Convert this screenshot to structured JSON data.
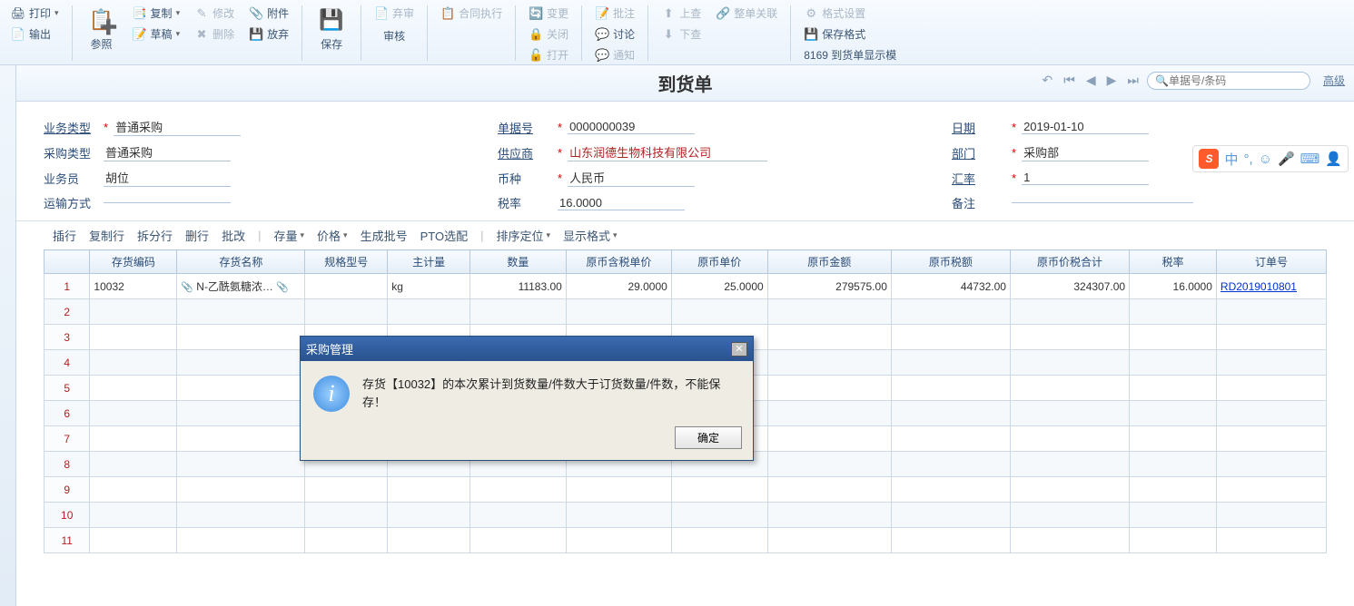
{
  "toolbar": {
    "print": "打印",
    "output": "输出",
    "ref": "参照",
    "copy": "复制",
    "modify": "修改",
    "attach": "附件",
    "draft": "草稿",
    "delete": "删除",
    "abandon": "放弃",
    "save": "保存",
    "discard_review": "弃审",
    "review": "审核",
    "contract_exec": "合同执行",
    "change": "变更",
    "close": "关闭",
    "open": "打开",
    "batch_review": "批注",
    "discuss": "讨论",
    "notify": "通知",
    "up_query": "上查",
    "down_query": "下查",
    "whole_assoc": "整单关联",
    "format_set": "格式设置",
    "save_format": "保存格式",
    "format_desc": "8169 到货单显示模"
  },
  "title": "到货单",
  "nav": {
    "search_placeholder": "单据号/条码",
    "advanced": "高级"
  },
  "form": {
    "biz_type_lbl": "业务类型",
    "biz_type": "普通采购",
    "doc_no_lbl": "单据号",
    "doc_no": "0000000039",
    "date_lbl": "日期",
    "date": "2019-01-10",
    "buy_type_lbl": "采购类型",
    "buy_type": "普通采购",
    "supplier_lbl": "供应商",
    "supplier": "山东润德生物科技有限公司",
    "dept_lbl": "部门",
    "dept": "采购部",
    "clerk_lbl": "业务员",
    "clerk": "胡位",
    "currency_lbl": "币种",
    "currency": "人民币",
    "rate_lbl": "汇率",
    "rate": "1",
    "ship_lbl": "运输方式",
    "ship": "",
    "tax_lbl": "税率",
    "tax": "16.0000",
    "memo_lbl": "备注",
    "memo": ""
  },
  "grid_tb": {
    "insert_row": "插行",
    "copy_row": "复制行",
    "split_row": "拆分行",
    "del_row": "删行",
    "batch_mod": "批改",
    "stock": "存量",
    "price": "价格",
    "gen_batch": "生成批号",
    "pto": "PTO选配",
    "sort_locate": "排序定位",
    "display_fmt": "显示格式"
  },
  "cols": {
    "inv_code": "存货编码",
    "inv_name": "存货名称",
    "spec": "规格型号",
    "main_uom": "主计量",
    "qty": "数量",
    "tax_price": "原币含税单价",
    "price": "原币单价",
    "amount": "原币金额",
    "tax_amt": "原币税额",
    "total": "原币价税合计",
    "tax_rate": "税率",
    "order_no": "订单号"
  },
  "row1": {
    "code": "10032",
    "name": "N-乙酰氨糖浓…",
    "uom": "kg",
    "qty": "11183.00",
    "tax_price": "29.0000",
    "price": "25.0000",
    "amount": "279575.00",
    "tax_amt": "44732.00",
    "total": "324307.00",
    "tax_rate": "16.0000",
    "order": "RD2019010801"
  },
  "row_nums": [
    "1",
    "2",
    "3",
    "4",
    "5",
    "6",
    "7",
    "8",
    "9",
    "10",
    "11"
  ],
  "dialog": {
    "title": "采购管理",
    "msg": "存货【10032】的本次累计到货数量/件数大于订货数量/件数，不能保存！",
    "ok": "确定"
  },
  "ime": {
    "zhong": "中"
  }
}
